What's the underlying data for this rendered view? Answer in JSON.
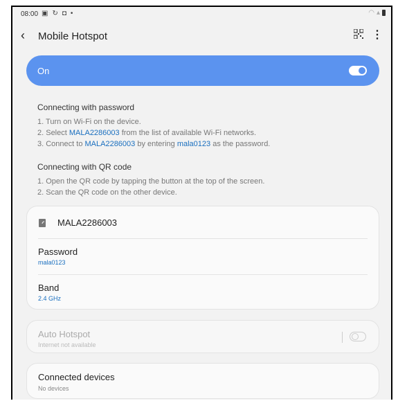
{
  "status": {
    "time": "08:00",
    "icons_left": [
      "gallery-icon",
      "sync-icon",
      "screenshot-icon",
      "dot-icon"
    ],
    "icons_right": [
      "wifi-icon",
      "signal-icon",
      "battery-icon"
    ]
  },
  "appbar": {
    "title": "Mobile Hotspot"
  },
  "toggle": {
    "label": "On",
    "on": true,
    "accent": "#5b93ef"
  },
  "password_section": {
    "title": "Connecting with password",
    "step1": "1. Turn on Wi-Fi on the device.",
    "step2_pre": "2. Select ",
    "step2_ssid": "MALA2286003",
    "step2_post": " from the list of available Wi-Fi networks.",
    "step3_pre": "3. Connect to ",
    "step3_ssid": "MALA2286003",
    "step3_mid": " by entering ",
    "step3_pass": "mala0123",
    "step3_post": " as the password."
  },
  "qr_section": {
    "title": "Connecting with QR code",
    "step1": "1. Open the QR code by tapping the button at the top of the screen.",
    "step2": "2. Scan the QR code on the other device."
  },
  "network": {
    "name": "MALA2286003",
    "password_label": "Password",
    "password_value": "mala0123",
    "band_label": "Band",
    "band_value": "2.4 GHz"
  },
  "auto_hotspot": {
    "label": "Auto Hotspot",
    "subtitle": "Internet not available",
    "enabled": false
  },
  "connected": {
    "label": "Connected devices",
    "subtitle": "No devices"
  }
}
